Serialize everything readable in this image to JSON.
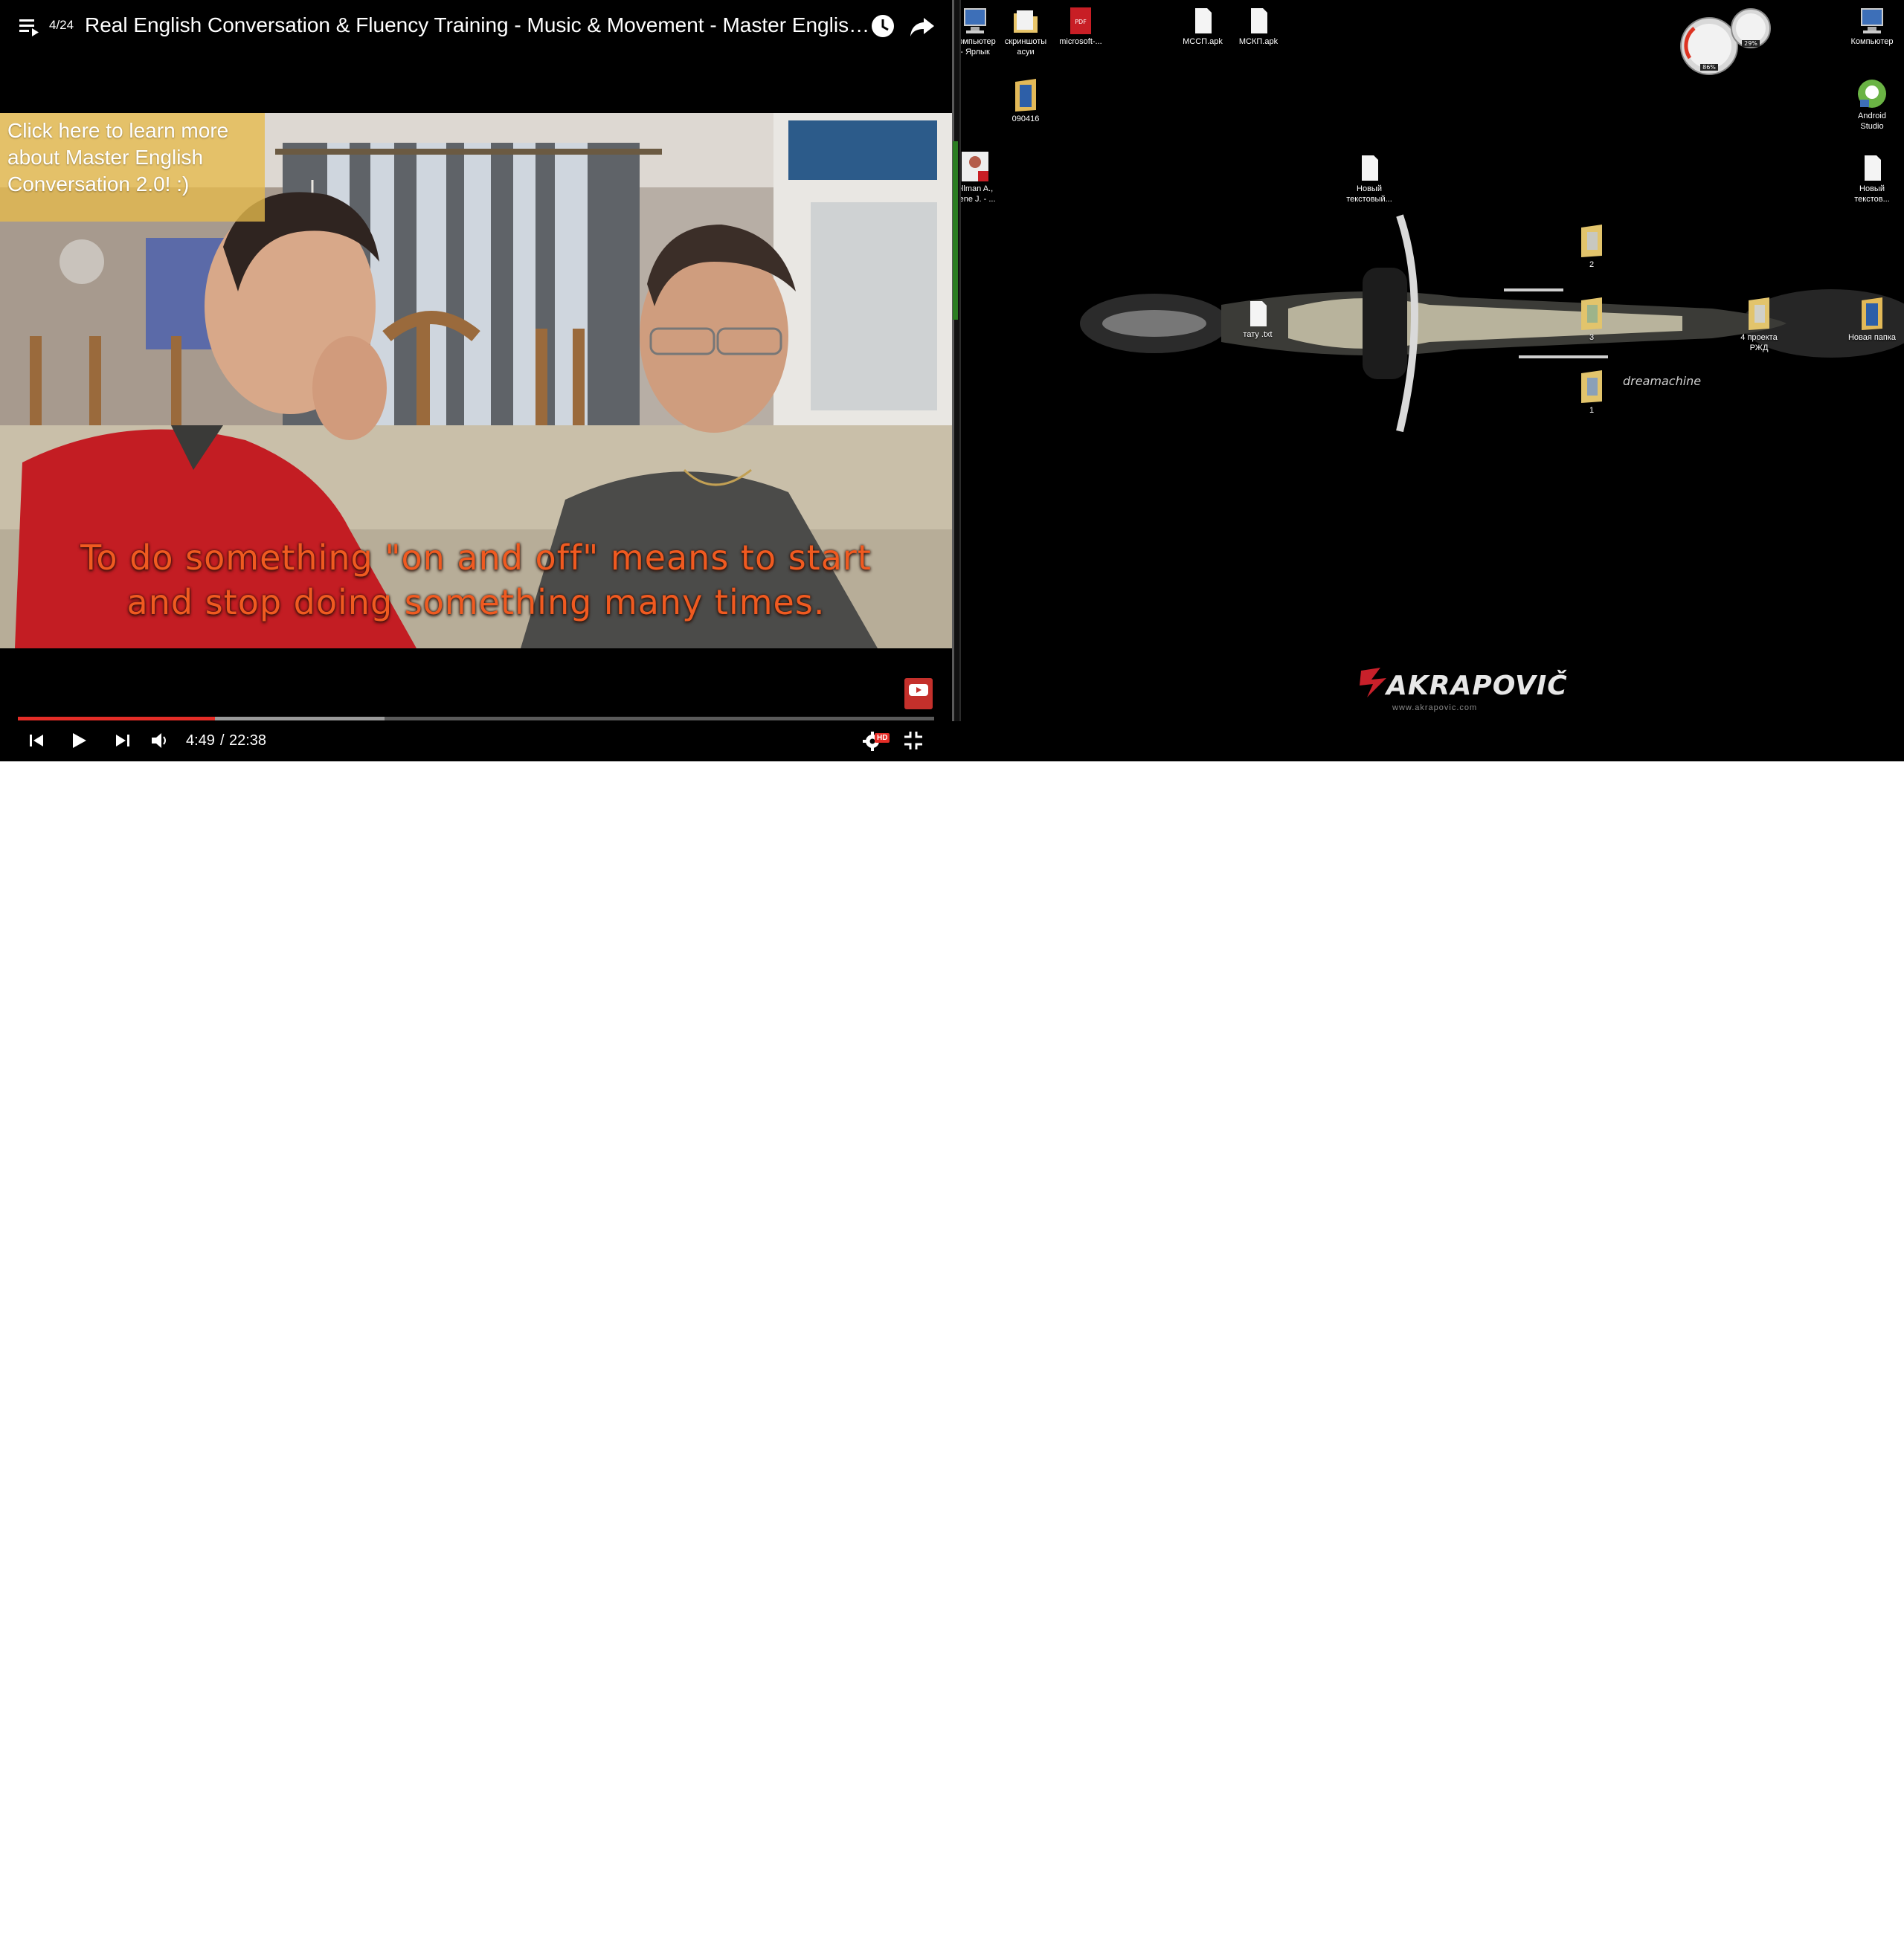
{
  "player": {
    "playlist_position": "4/24",
    "title": "Real English Conversation & Fluency Training - Music & Movement - Master English C...",
    "annotation": {
      "line1": "Click here to learn more",
      "line2": "about Master English",
      "line3": "Conversation 2.0! :)"
    },
    "subtitles": {
      "line1": "To do something \"on and off\" means to start",
      "line2": "and stop doing something many times."
    },
    "progress": {
      "played_fraction": 0.2155,
      "buffered_fraction": 0.185
    },
    "time_current": "4:49",
    "time_separator": "/",
    "time_total": "22:38",
    "hd_badge": "HD",
    "icons": {
      "playlist": "playlist-icon",
      "watch_later": "clock-icon",
      "share": "share-icon",
      "subscribe": "youtube-subscribe-icon",
      "previous": "skip-previous-icon",
      "play": "play-icon",
      "next": "skip-next-icon",
      "volume": "volume-icon",
      "settings": "gear-icon",
      "exit_fullscreen": "exit-fullscreen-icon"
    },
    "colors": {
      "accent": "#e52d27",
      "subtitle": "#f05a20",
      "annotation": "#e6ba4c"
    }
  },
  "desktop": {
    "icons": [
      {
        "label_line1": "компьютер",
        "label_line2": "- Ярлык",
        "type": "computer-shortcut"
      },
      {
        "label_line1": "скриншоты",
        "label_line2": "асуи",
        "type": "folder"
      },
      {
        "label_line1": "microsoft-...",
        "label_line2": "",
        "type": "pdf"
      },
      {
        "label_line1": "МССП.apk",
        "label_line2": "",
        "type": "file"
      },
      {
        "label_line1": "МСКП.apk",
        "label_line2": "",
        "type": "file"
      },
      {
        "label_line1": "090416",
        "label_line2": "",
        "type": "folder"
      },
      {
        "label_line1": "ellman A.,",
        "label_line2": "eene J. - ...",
        "type": "pdf"
      },
      {
        "label_line1": "Новый",
        "label_line2": "текстовый...",
        "type": "file"
      },
      {
        "label_line1": "тату .txt",
        "label_line2": "",
        "type": "file"
      },
      {
        "label_line1": "2",
        "label_line2": "",
        "type": "folder"
      },
      {
        "label_line1": "3",
        "label_line2": "",
        "type": "folder"
      },
      {
        "label_line1": "1",
        "label_line2": "",
        "type": "folder"
      },
      {
        "label_line1": "4 проекта",
        "label_line2": "РЖД",
        "type": "folder"
      },
      {
        "label_line1": "Компьютер",
        "label_line2": "",
        "type": "computer"
      },
      {
        "label_line1": "Android",
        "label_line2": "Studio",
        "type": "android"
      },
      {
        "label_line1": "Новый",
        "label_line2": "текстов...",
        "type": "file"
      },
      {
        "label_line1": "Новая папка",
        "label_line2": "",
        "type": "folder"
      }
    ],
    "gadget": {
      "cpu": "86%",
      "ram": "29%"
    },
    "wallpaper": {
      "bike_text": "dreamachine",
      "logo_text": "AKRAPOVIČ",
      "logo_url": "www.akrapovic.com",
      "logo_color": "#c8202a"
    }
  }
}
